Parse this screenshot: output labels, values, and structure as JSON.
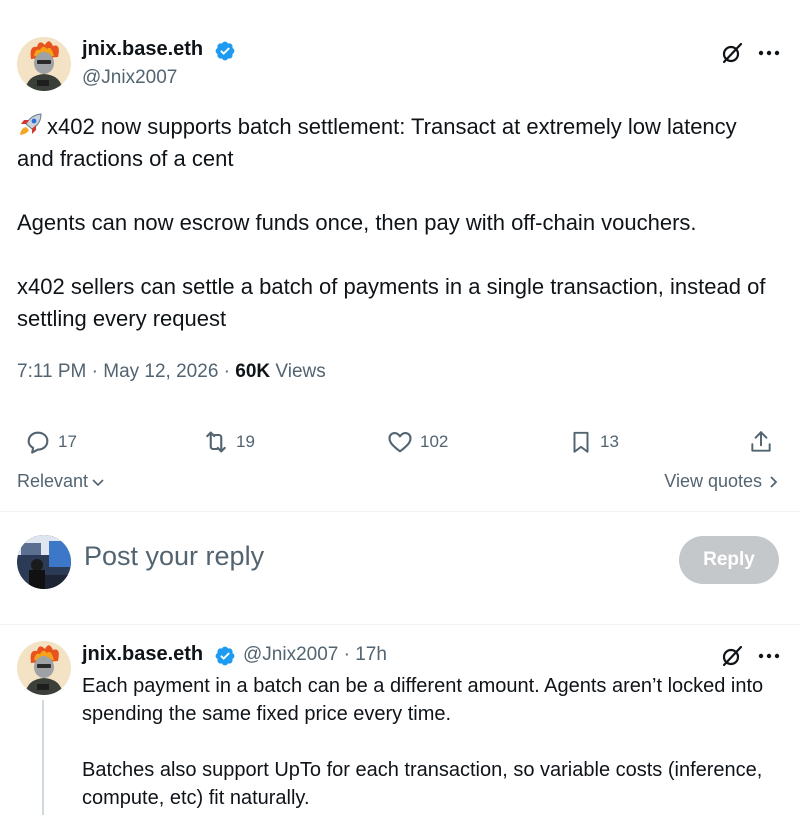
{
  "tweet": {
    "author_name": "jnix.base.eth",
    "author_handle": "@Jnix2007",
    "rocket_icon": "rocket-icon",
    "paragraphs": [
      "x402 now supports batch settlement: Transact at extremely low latency and fractions of a cent",
      "Agents can now escrow funds once, then pay with off-chain vouchers.",
      "x402 sellers can settle a batch of payments in a single transaction, instead of settling every request"
    ],
    "time": "7:11 PM",
    "separator": "·",
    "date": "May 12, 2026",
    "views_count": "60K",
    "views_label": "Views"
  },
  "actions": {
    "replies": "17",
    "reposts": "19",
    "likes": "102",
    "bookmarks": "13"
  },
  "sort": {
    "label": "Relevant",
    "view_quotes": "View quotes"
  },
  "composer": {
    "placeholder": "Post your reply",
    "button": "Reply"
  },
  "reply": {
    "author_name": "jnix.base.eth",
    "author_handle": "@Jnix2007",
    "separator": "·",
    "time_ago": "17h",
    "paragraphs": [
      "Each payment in a batch can be a different amount. Agents aren’t locked into spending the same fixed price every time.",
      "Batches also support UpTo for each transaction, so variable costs (inference, compute, etc) fit naturally."
    ]
  },
  "colors": {
    "text_primary": "#0f1419",
    "text_secondary": "#536471",
    "verified_blue": "#1d9bf0",
    "reply_button_disabled": "#c5c8cb",
    "divider": "#eff3f4"
  }
}
